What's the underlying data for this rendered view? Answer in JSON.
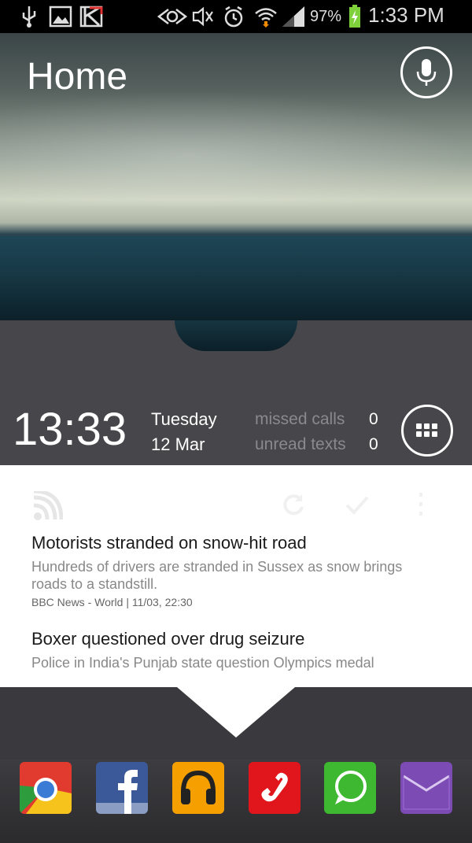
{
  "status_bar": {
    "battery_percent": "97%",
    "time": "1:33 PM",
    "icons": [
      "usb-icon",
      "gallery-icon",
      "kaspersky-icon",
      "nfc-icon",
      "mute-icon",
      "alarm-icon",
      "wifi-icon",
      "signal-icon",
      "battery-charging-icon"
    ]
  },
  "header": {
    "title": "Home"
  },
  "info_panel": {
    "clock": "13:33",
    "day": "Tuesday",
    "date": "12  Mar",
    "missed_calls_label": "missed calls",
    "missed_calls_count": "0",
    "unread_texts_label": "unread texts",
    "unread_texts_count": "0"
  },
  "feed": {
    "articles": [
      {
        "title": "Motorists stranded on snow-hit road",
        "summary": "Hundreds of drivers are stranded in Sussex as snow brings roads to a standstill.",
        "source": "BBC News - World | 11/03, 22:30"
      },
      {
        "title": "Boxer questioned over drug seizure",
        "summary": "Police in India's Punjab state question Olympics medal"
      }
    ]
  },
  "dock": {
    "apps": [
      "Chrome",
      "Facebook",
      "Music",
      "Phone",
      "WhatsApp",
      "Email"
    ]
  },
  "colors": {
    "panel": "#47464a",
    "background": "#3a393d",
    "chrome_red": "#e13a2f",
    "facebook_blue": "#3b5998",
    "music_orange": "#f5a000",
    "phone_red": "#e0161c",
    "whatsapp_green": "#3db830",
    "email_purple": "#7c4bb3"
  }
}
